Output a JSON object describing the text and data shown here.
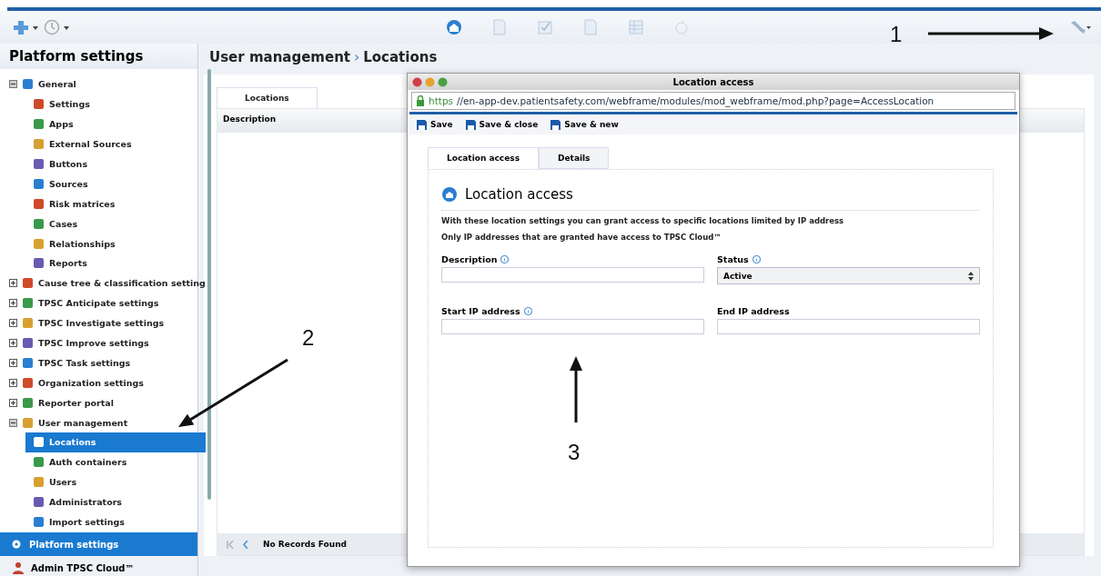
{
  "toolbar": {
    "left_tools": [
      {
        "kind": "plus"
      },
      {
        "kind": "clock"
      }
    ],
    "center_tools": [
      {
        "kind": "home",
        "disabled": false
      },
      {
        "kind": "doc",
        "disabled": true
      },
      {
        "kind": "check",
        "disabled": true
      },
      {
        "kind": "doc",
        "disabled": true
      },
      {
        "kind": "grid",
        "disabled": true
      },
      {
        "kind": "apple",
        "disabled": true
      }
    ]
  },
  "sidebar": {
    "title": "Platform settings",
    "items": [
      {
        "label": "General",
        "expanded": true,
        "selected": false,
        "children": [
          {
            "label": "Settings",
            "selected": false
          },
          {
            "label": "Apps",
            "selected": false
          },
          {
            "label": "External Sources",
            "selected": false
          },
          {
            "label": "Buttons",
            "selected": false
          },
          {
            "label": "Sources",
            "selected": false
          },
          {
            "label": "Risk matrices",
            "selected": false
          },
          {
            "label": "Cases",
            "selected": false
          },
          {
            "label": "Relationships",
            "selected": false
          },
          {
            "label": "Reports",
            "selected": false
          }
        ]
      },
      {
        "label": "Cause tree & classification setting",
        "expanded": false,
        "selected": false
      },
      {
        "label": "TPSC Anticipate settings",
        "expanded": false,
        "selected": false
      },
      {
        "label": "TPSC Investigate settings",
        "expanded": false,
        "selected": false
      },
      {
        "label": "TPSC Improve settings",
        "expanded": false,
        "selected": false
      },
      {
        "label": "TPSC Task settings",
        "expanded": false,
        "selected": false
      },
      {
        "label": "Organization settings",
        "expanded": false,
        "selected": false
      },
      {
        "label": "Reporter portal",
        "expanded": false,
        "selected": false
      },
      {
        "label": "User management",
        "expanded": true,
        "selected": false,
        "children": [
          {
            "label": "Locations",
            "selected": true
          },
          {
            "label": "Auth containers",
            "selected": false
          },
          {
            "label": "Users",
            "selected": false
          },
          {
            "label": "Administrators",
            "selected": false
          },
          {
            "label": "Import settings",
            "selected": false
          }
        ]
      }
    ],
    "footer_button": "Platform settings",
    "user": "Admin TPSC Cloud™"
  },
  "main": {
    "breadcrumb": [
      "User management",
      "Locations"
    ],
    "breadcrumb_separator": "›",
    "tabs": [
      {
        "label": "Locations",
        "selected": true
      }
    ],
    "columns": [
      "Description"
    ],
    "pager": "No Records Found"
  },
  "dialog": {
    "title": "Location access",
    "url_scheme": "https",
    "url": "//en-app-dev.patientsafety.com/webframe/modules/mod_webframe/mod.php?page=AccessLocation",
    "actions": [
      "Save",
      "Save & close",
      "Save & new"
    ],
    "tabs": [
      {
        "label": "Location access",
        "selected": true
      },
      {
        "label": "Details",
        "selected": false
      }
    ],
    "heading": "Location access",
    "intro": [
      "With these location settings you can grant access to specific locations limited by IP address",
      "Only IP addresses that are granted have access to TPSC Cloud™"
    ],
    "fields": [
      {
        "label": "Description",
        "info": true,
        "kind": "text"
      },
      {
        "label": "Status",
        "info": true,
        "kind": "select",
        "value": "Active"
      },
      {
        "label": "Start IP address",
        "info": true,
        "kind": "text"
      },
      {
        "label": "End IP address",
        "info": false,
        "kind": "text"
      }
    ]
  },
  "callouts": [
    {
      "label": "1"
    },
    {
      "label": "2"
    },
    {
      "label": "3"
    }
  ]
}
